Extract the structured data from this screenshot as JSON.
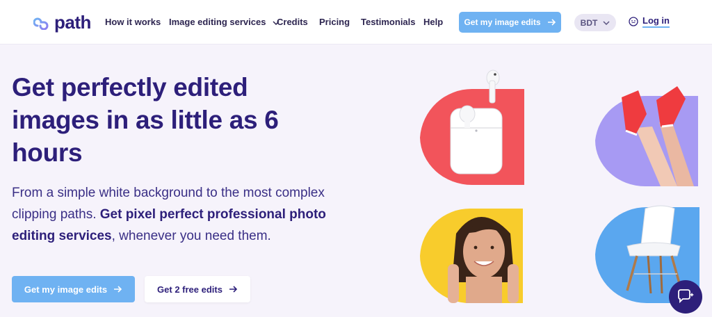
{
  "header": {
    "logo_text": "path",
    "nav": [
      {
        "label": "How it works"
      },
      {
        "label": "Image editing services"
      },
      {
        "label": "Credits"
      },
      {
        "label": "Pricing"
      },
      {
        "label": "Testimonials"
      },
      {
        "label": "Help"
      }
    ],
    "cta_label": "Get my image edits",
    "currency": "BDT",
    "login_label": "Log in"
  },
  "hero": {
    "title": "Get perfectly edited images in as little as 6 hours",
    "sub_plain_1": "From a simple white background to the most complex clipping paths. ",
    "sub_bold": "Get pixel perfect professional photo editing services",
    "sub_plain_2": ", whenever you need them.",
    "primary_button": "Get my image edits",
    "secondary_button": "Get 2 free edits"
  },
  "tiles": [
    {
      "name": "airpods",
      "color": "#f2545b"
    },
    {
      "name": "legs-sneakers",
      "color": "#a79af3"
    },
    {
      "name": "woman-face",
      "color": "#f8cc2c"
    },
    {
      "name": "white-chair",
      "color": "#5aa7ef"
    }
  ],
  "colors": {
    "brand": "#2d1f7a",
    "accent": "#6fb2f2",
    "background": "#f6f3fb"
  },
  "icons": {
    "logo": "path-logo-icon",
    "chevron": "chevron-down-icon",
    "arrow": "arrow-right-icon",
    "user": "user-circle-icon",
    "chat": "chat-bubbles-icon"
  }
}
